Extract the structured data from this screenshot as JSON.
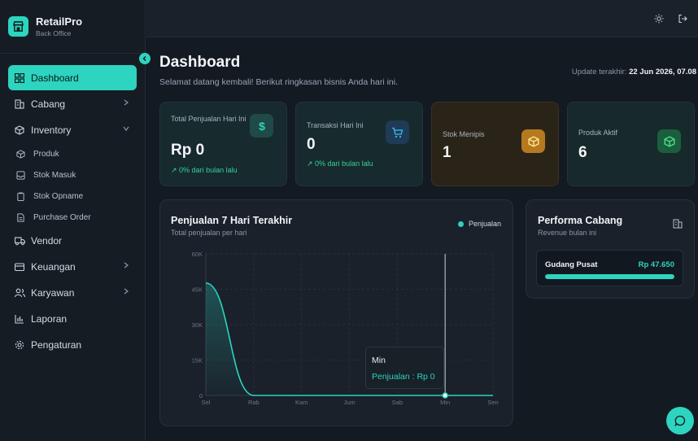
{
  "brand": {
    "name": "RetailPro",
    "subtitle": "Back Office"
  },
  "sidebar": {
    "items": [
      {
        "label": "Dashboard",
        "icon": "grid-icon",
        "active": true
      },
      {
        "label": "Cabang",
        "icon": "building-icon",
        "chevron": "right"
      },
      {
        "label": "Inventory",
        "icon": "box-icon",
        "chevron": "down"
      },
      {
        "label": "Vendor",
        "icon": "truck-icon"
      },
      {
        "label": "Keuangan",
        "icon": "wallet-icon",
        "chevron": "right"
      },
      {
        "label": "Karyawan",
        "icon": "users-icon",
        "chevron": "right"
      },
      {
        "label": "Laporan",
        "icon": "bar-chart-icon"
      },
      {
        "label": "Pengaturan",
        "icon": "gear-icon"
      }
    ],
    "inventory_sub": [
      {
        "label": "Produk",
        "icon": "package-icon"
      },
      {
        "label": "Stok Masuk",
        "icon": "inbox-icon"
      },
      {
        "label": "Stok Opname",
        "icon": "clipboard-icon"
      },
      {
        "label": "Purchase Order",
        "icon": "file-icon"
      }
    ]
  },
  "header": {
    "title": "Dashboard",
    "subtitle": "Selamat datang kembali! Berikut ringkasan bisnis Anda hari ini.",
    "update_label": "Update terakhir:",
    "update_value": "22 Jun 2026, 07.08"
  },
  "stats": [
    {
      "label": "Total Penjualan Hari Ini",
      "value": "Rp 0",
      "trend": "0% dari bulan lalu",
      "icon": "dollar-icon",
      "accent": "#2dd4bf"
    },
    {
      "label": "Transaksi Hari Ini",
      "value": "0",
      "trend": "0% dari bulan lalu",
      "icon": "cart-icon",
      "accent": "#38bdf8"
    },
    {
      "label": "Stok Menipis",
      "value": "1",
      "icon": "box-warning-icon",
      "accent": "#f59e0b"
    },
    {
      "label": "Produk Aktif",
      "value": "6",
      "icon": "box-active-icon",
      "accent": "#22c55e"
    }
  ],
  "sales_chart": {
    "title": "Penjualan 7 Hari Terakhir",
    "subtitle": "Total penjualan per hari",
    "legend": "Penjualan",
    "tooltip": {
      "title": "Min",
      "value": "Penjualan : Rp 0"
    }
  },
  "chart_data": {
    "type": "area",
    "title": "Penjualan 7 Hari Terakhir",
    "categories": [
      "Sel",
      "Rab",
      "Kam",
      "Jum",
      "Sab",
      "Min",
      "Sen"
    ],
    "series": [
      {
        "name": "Penjualan",
        "values": [
          47650,
          0,
          0,
          0,
          0,
          0,
          0
        ]
      }
    ],
    "y_ticks": [
      "0",
      "15K",
      "30K",
      "45K",
      "60K"
    ],
    "ylim": [
      0,
      60000
    ],
    "grid": true,
    "legend_position": "top-right",
    "color": "#2dd4bf",
    "highlight_category": "Min"
  },
  "branch_panel": {
    "title": "Performa Cabang",
    "subtitle": "Revenue bulan ini",
    "branches": [
      {
        "name": "Gudang Pusat",
        "value": "Rp 47.650",
        "fill": 1.0
      }
    ]
  },
  "colors": {
    "accent": "#2dd4bf",
    "background": "#141a22",
    "panel": "#1a212b"
  }
}
